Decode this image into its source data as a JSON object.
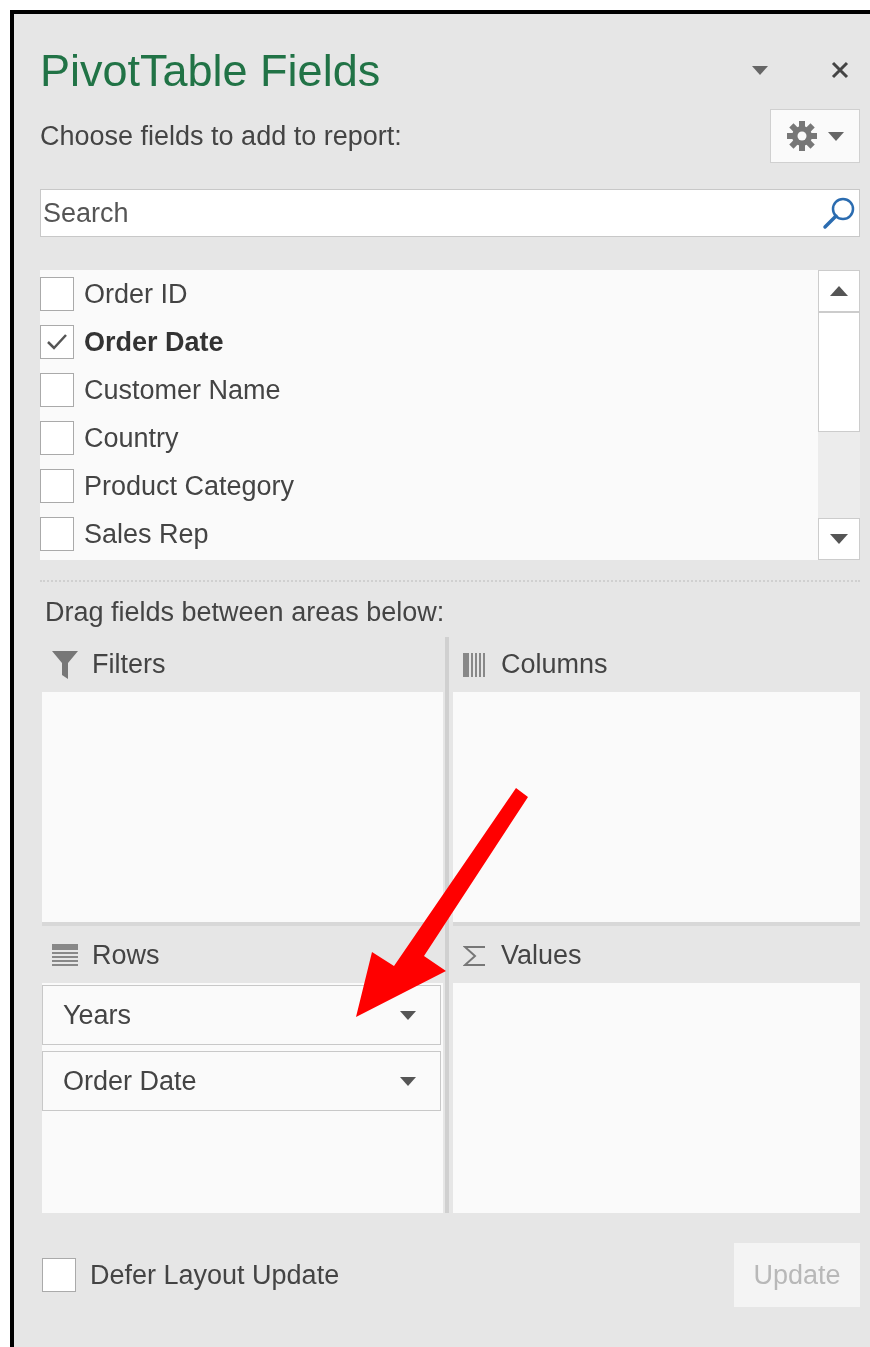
{
  "panel": {
    "title": "PivotTable Fields",
    "prompt": "Choose fields to add to report:",
    "search": {
      "placeholder": "Search"
    },
    "fields": [
      {
        "label": "Order ID",
        "checked": false
      },
      {
        "label": "Order Date",
        "checked": true
      },
      {
        "label": "Customer Name",
        "checked": false
      },
      {
        "label": "Country",
        "checked": false
      },
      {
        "label": "Product Category",
        "checked": false
      },
      {
        "label": "Sales Rep",
        "checked": false
      }
    ],
    "areas_prompt": "Drag fields between areas below:",
    "areas": [
      {
        "kind": "filters",
        "label": "Filters"
      },
      {
        "kind": "columns",
        "label": "Columns"
      },
      {
        "kind": "rows",
        "label": "Rows",
        "items": [
          "Years",
          "Order Date"
        ]
      },
      {
        "kind": "values",
        "label": "Values"
      }
    ],
    "defer": {
      "label": "Defer Layout Update",
      "checked": false
    },
    "update_button": {
      "label": "Update",
      "disabled": true
    }
  }
}
